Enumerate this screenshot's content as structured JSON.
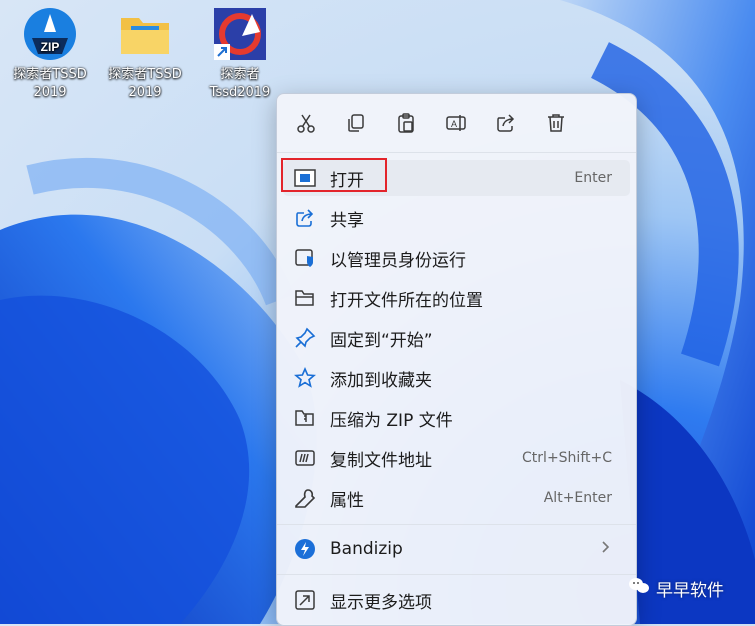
{
  "desktop": {
    "icons": [
      {
        "label_line1": "探索者TSSD",
        "label_line2": "2019",
        "icon": "zip-archive-icon"
      },
      {
        "label_line1": "探索者TSSD",
        "label_line2": "2019",
        "icon": "folder-icon"
      },
      {
        "label_line1": "探索者",
        "label_line2": "Tssd2019",
        "icon": "tssd-app-shortcut-icon"
      }
    ]
  },
  "context_menu": {
    "toolbar": [
      "cut-icon",
      "copy-icon",
      "paste-icon",
      "rename-icon",
      "share-icon",
      "delete-icon"
    ],
    "items": [
      {
        "label": "打开",
        "shortcut": "Enter",
        "icon": "open-window-icon"
      },
      {
        "label": "共享",
        "shortcut": "",
        "icon": "share-icon"
      },
      {
        "label": "以管理员身份运行",
        "shortcut": "",
        "icon": "admin-shield-icon"
      },
      {
        "label": "打开文件所在的位置",
        "shortcut": "",
        "icon": "folder-open-icon"
      },
      {
        "label": "固定到“开始”",
        "shortcut": "",
        "icon": "pin-icon"
      },
      {
        "label": "添加到收藏夹",
        "shortcut": "",
        "icon": "star-icon"
      },
      {
        "label": "压缩为 ZIP 文件",
        "shortcut": "",
        "icon": "zip-folder-icon"
      },
      {
        "label": "复制文件地址",
        "shortcut": "Ctrl+Shift+C",
        "icon": "copy-path-icon"
      },
      {
        "label": "属性",
        "shortcut": "Alt+Enter",
        "icon": "wrench-icon"
      },
      {
        "label": "Bandizip",
        "shortcut": "",
        "icon": "bandizip-icon"
      },
      {
        "label": "显示更多选项",
        "shortcut": "",
        "icon": "more-options-icon"
      }
    ]
  },
  "watermark": {
    "text": "早早软件"
  },
  "colors": {
    "accent": "#005fb8",
    "highlight_box": "#e3242b"
  }
}
